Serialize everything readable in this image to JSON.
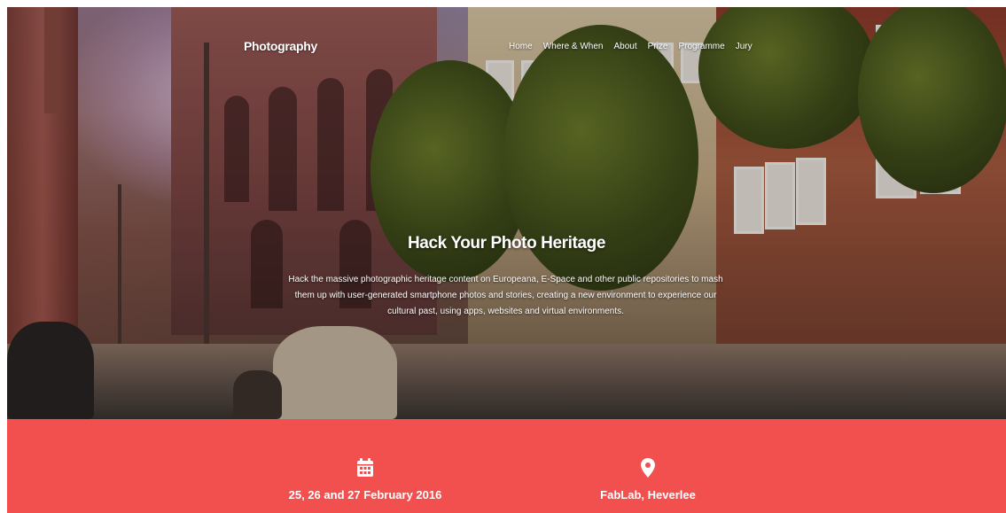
{
  "brand": "Photography",
  "nav": [
    "Home",
    "Where & When",
    "About",
    "Prize",
    "Programme",
    "Jury"
  ],
  "hero": {
    "title": "Hack Your Photo Heritage",
    "description": "Hack the massive photographic heritage content on Europeana, E-Space and other public repositories to mash them up with user-generated smartphone photos and stories, creating a new environment to experience our cultural past, using apps, websites and virtual environments."
  },
  "info": {
    "date": {
      "icon": "calendar-icon",
      "text": "25, 26 and 27 February 2016"
    },
    "location": {
      "icon": "map-marker-icon",
      "text": "FabLab, Heverlee"
    }
  },
  "colors": {
    "accent": "#f24f4f",
    "text": "#ffffff"
  }
}
